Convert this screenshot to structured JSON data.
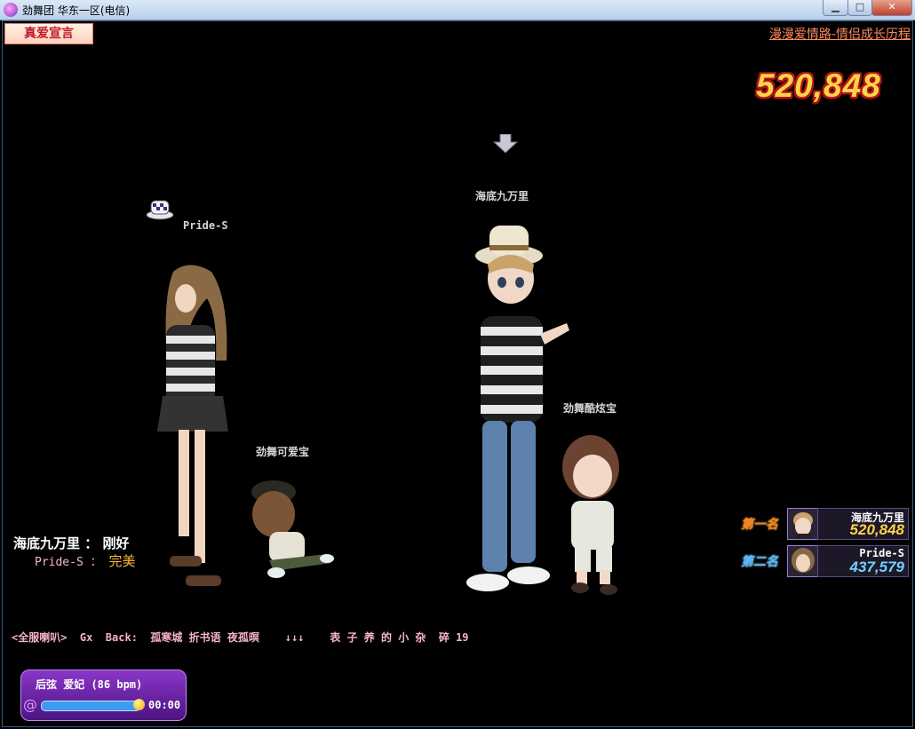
{
  "window": {
    "title": "劲舞团 华东一区(电信)",
    "min_label": "▁",
    "max_label": "□",
    "close_label": "✕"
  },
  "hud": {
    "zhenai_label": "真爱宣言",
    "marquee": "漫漫爱情路-情侣成长历程",
    "score": "520,848"
  },
  "players": [
    {
      "name": "Pride-S"
    },
    {
      "name": "海底九万里"
    },
    {
      "name": "劲舞可爱宝"
    },
    {
      "name": "劲舞酷炫宝"
    }
  ],
  "judgement": {
    "row1_player": "海底九万里",
    "row1_sep": "：",
    "row1_value": "刚好",
    "row2_player": "Pride-S",
    "row2_sep": "：",
    "row2_value": "完美"
  },
  "chat": {
    "line": "<全服喇叭>  Gx  Back:  孤寒城 折书语 夜孤暝    ↓↓↓    表 子 养 的 小 杂  碎 19"
  },
  "ranking": [
    {
      "badge": "第一名",
      "name": "海底九万里",
      "score": "520,848",
      "badge_color": "#ff7f1e",
      "score_color": "#ffd34a"
    },
    {
      "badge": "第二名",
      "name": "Pride-S",
      "score": "437,579",
      "badge_color": "#4bb7ff",
      "score_color": "#73d2ff"
    }
  ],
  "music": {
    "title": "后弦  爱妃 (86 bpm)",
    "time": "00:00",
    "progress": 1.0
  }
}
